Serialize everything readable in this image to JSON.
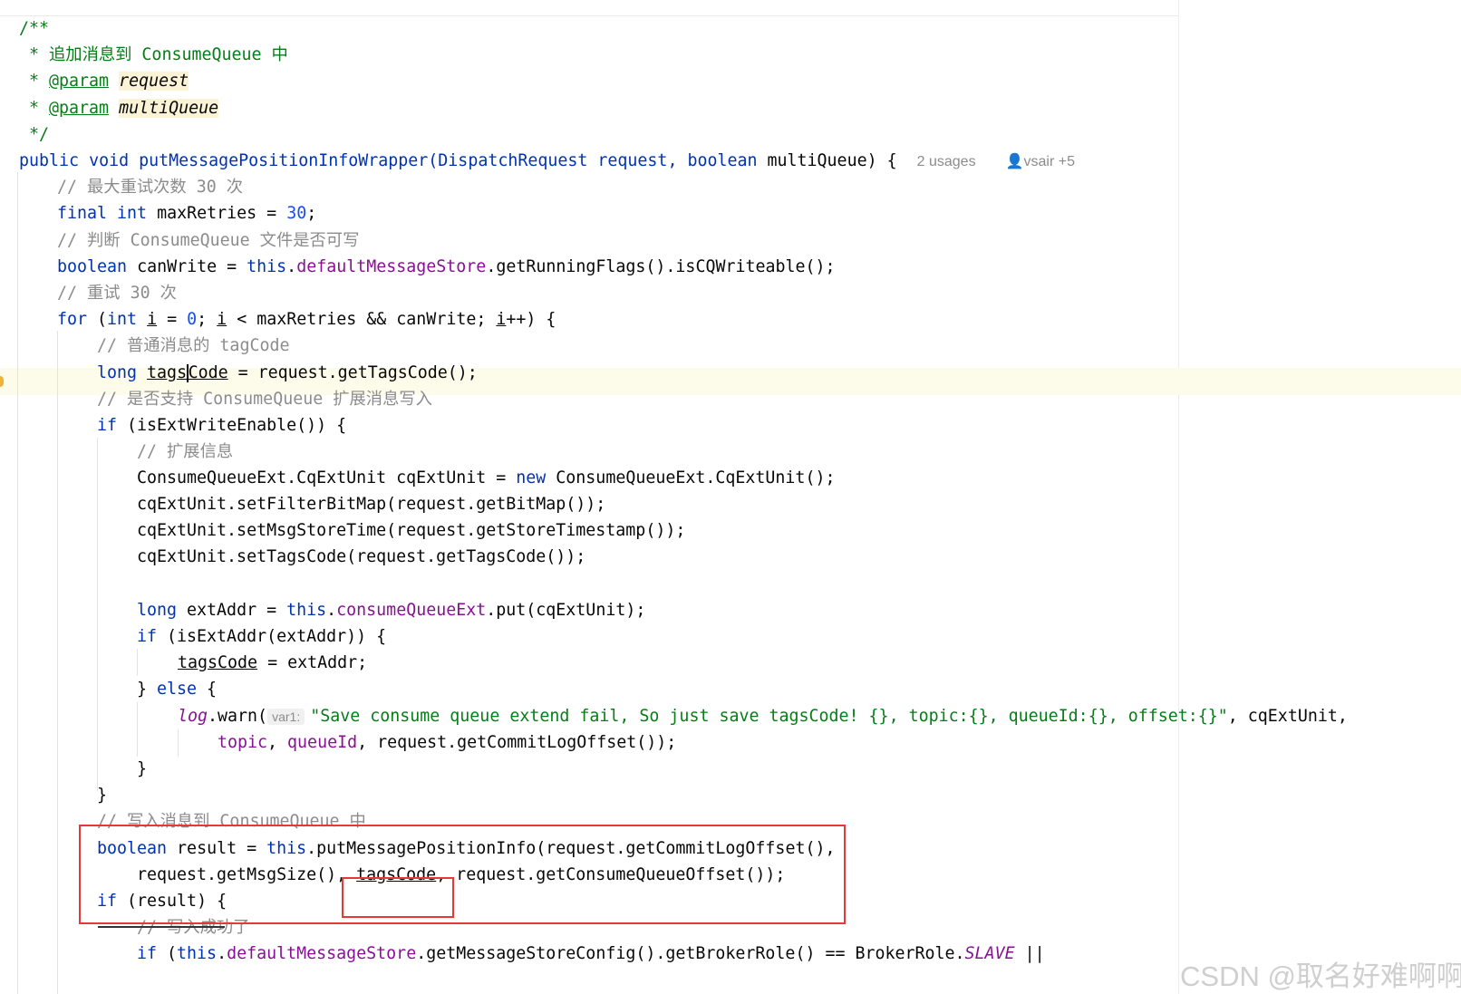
{
  "editor": {
    "usages_hint": "2 usages",
    "author_hint": "vsair +5",
    "person_icon": "person-icon",
    "param_inlay": "var1:",
    "watermark": "CSDN @取名好难啊啊"
  },
  "tokens": {
    "doc_open": "/**",
    "doc_star_title": " * 追加消息到 ConsumeQueue 中",
    "doc_star": " * ",
    "at_param": "@param",
    "p_request": "request",
    "p_multi": "multiQueue",
    "doc_close": " */",
    "kw_public": "public",
    "kw_void": "void",
    "method_sig": "putMessagePositionInfoWrapper(DispatchRequest request, ",
    "kw_boolean": "boolean",
    "sig_tail": "multiQueue) {",
    "c_max": "// 最大重试次数 30 次",
    "kw_final": "final",
    "kw_int": "int",
    "max_assign": "maxRetries = ",
    "n_30": "30",
    "semi": ";",
    "c_judge": "// 判断 ConsumeQueue 文件是否可写",
    "canwrite_assign": "canWrite = ",
    "kw_this": "this",
    "dot": ".",
    "f_store": "defaultMessageStore",
    "running_flags": ".getRunningFlags().isCQWriteable();",
    "c_retry": "// 重试 30 次",
    "kw_for": "for",
    "for_open": " (",
    "var_i": "i",
    "eq": " = ",
    "n_0": "0",
    "semi_sp": "; ",
    "for_cond": " < maxRetries && canWrite; ",
    "for_inc": "++) {",
    "c_normal": "// 普通消息的 tagCode",
    "kw_long": "long",
    "tags_a": "tags",
    "tags_b": "Code",
    "tags_init": " = request.getTagsCode();",
    "c_ext_support": "// 是否支持 ConsumeQueue 扩展消息写入",
    "kw_if": "if",
    "if_ext_enable": " (isExtWriteEnable()) {",
    "c_ext_info": "// 扩展信息",
    "ext_decl": "ConsumeQueueExt.CqExtUnit cqExtUnit = ",
    "kw_new": "new",
    "ext_ctor": " ConsumeQueueExt.CqExtUnit();",
    "set_filter": "cqExtUnit.setFilterBitMap(request.getBitMap());",
    "set_time": "cqExtUnit.setMsgStoreTime(request.getStoreTimestamp());",
    "set_tags": "cqExtUnit.setTagsCode(request.getTagsCode());",
    "ext_addr_decl": " extAddr = ",
    "f_cqext": "consumeQueueExt",
    "put_call": ".put(cqExtUnit);",
    "if_is_ext": " (isExtAddr(extAddr)) {",
    "tags_code": "tagsCode",
    "assign_ext": " = extAddr;",
    "close_else": "} ",
    "kw_else": "else",
    "open_brace": " {",
    "f_log": "log",
    "warn_call": ".warn(",
    "warn_str": "\"Save consume queue extend fail, So just save tagsCode! {}, topic:{}, queueId:{}, offset:{}\"",
    "warn_tail": ", cqExtUnit,",
    "f_topic": "topic",
    "comma_sp": ", ",
    "f_queueid": "queueId",
    "commit_offset_tail": "request.getCommitLogOffset());",
    "close_brace": "}",
    "c_write": "// 写入消息到 ConsumeQueue 中",
    "result_assign": " result = ",
    "put_info": ".putMessagePositionInfo(request.getCommitLogOffset(),",
    "msg_size": "request.getMsgSize(), ",
    "comma": ",",
    "cq_offset": " request.getConsumeQueueOffset());",
    "if_result": " (result) {",
    "c_success": "// 写入成功了",
    "get_config": ".getMessageStoreConfig().getBrokerRole() == BrokerRole.",
    "slave": "SLAVE",
    "or_op": " ||"
  }
}
